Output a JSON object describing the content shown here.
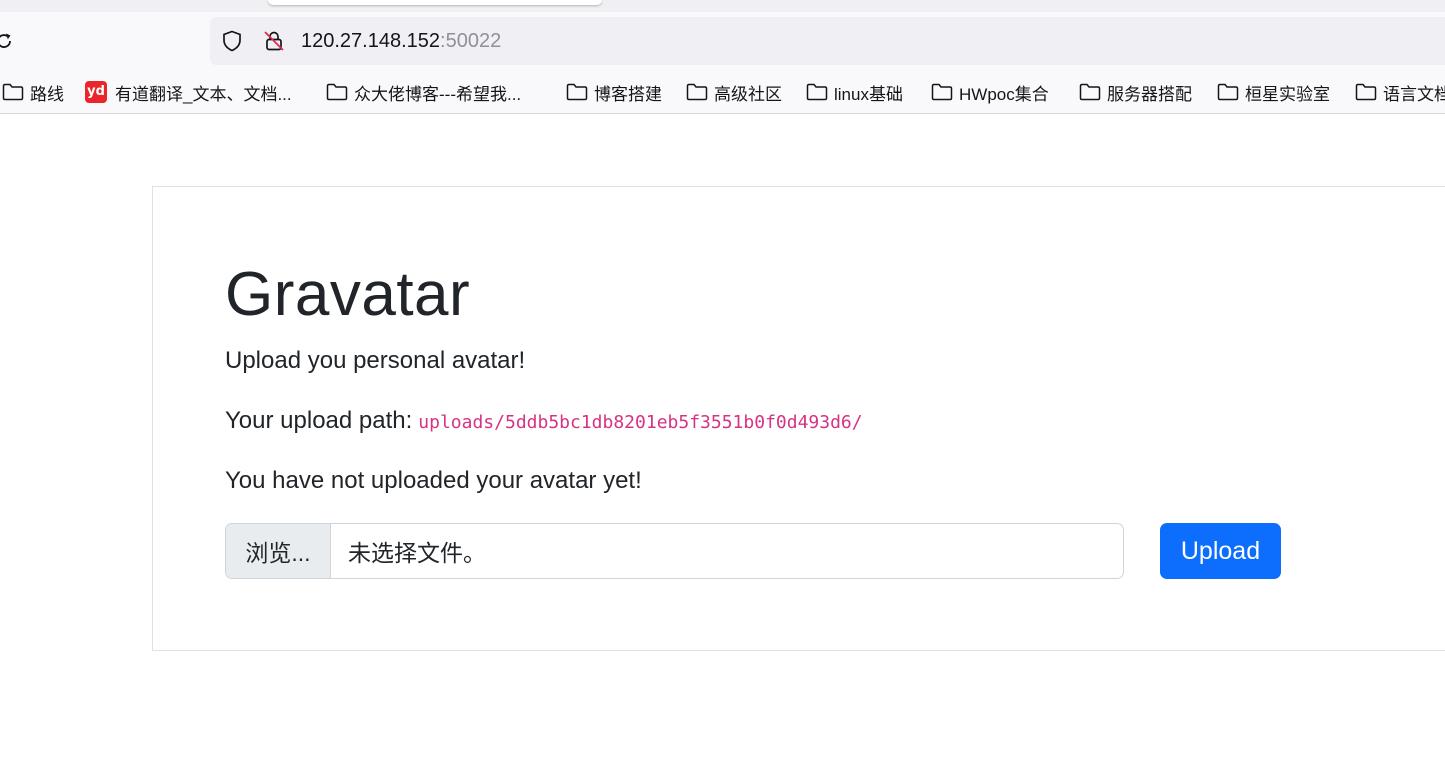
{
  "browser": {
    "url_host": "120.27.148.152",
    "url_port": ":50022"
  },
  "bookmarks": [
    {
      "label": "路线",
      "icon": "folder-icon"
    },
    {
      "label": "有道翻译_文本、文档...",
      "icon": "youdao-icon",
      "icon_text": "yd"
    },
    {
      "label": "众大佬博客---希望我...",
      "icon": "folder-icon"
    },
    {
      "label": "博客搭建",
      "icon": "folder-icon"
    },
    {
      "label": "高级社区",
      "icon": "folder-icon"
    },
    {
      "label": "linux基础",
      "icon": "folder-icon"
    },
    {
      "label": "HWpoc集合",
      "icon": "folder-icon"
    },
    {
      "label": "服务器搭配",
      "icon": "folder-icon"
    },
    {
      "label": "桓星实验室",
      "icon": "folder-icon"
    },
    {
      "label": "语言文档",
      "icon": "folder-icon"
    }
  ],
  "page": {
    "title": "Gravatar",
    "lead": "Upload you personal avatar!",
    "path_label": "Your upload path:",
    "path_value": "uploads/5ddb5bc1db8201eb5f3551b0f0d493d6/",
    "status": "You have not uploaded your avatar yet!",
    "file_input": {
      "browse_label": "浏览...",
      "placeholder": "未选择文件。"
    },
    "upload_label": "Upload"
  },
  "colors": {
    "primary": "#0d6efd",
    "code": "#d63384",
    "youdao": "#e8262b"
  }
}
